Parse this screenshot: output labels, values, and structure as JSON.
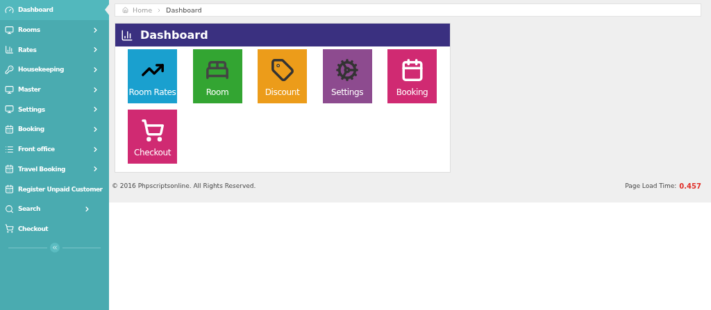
{
  "sidebar": {
    "items": [
      {
        "label": "Dashboard",
        "selected": true,
        "expandable": false
      },
      {
        "label": "Rooms",
        "selected": false,
        "expandable": true
      },
      {
        "label": "Rates",
        "selected": false,
        "expandable": true
      },
      {
        "label": "Housekeeping",
        "selected": false,
        "expandable": true
      },
      {
        "label": "Master",
        "selected": false,
        "expandable": true
      },
      {
        "label": "Settings",
        "selected": false,
        "expandable": true
      },
      {
        "label": "Booking",
        "selected": false,
        "expandable": true
      },
      {
        "label": "Front office",
        "selected": false,
        "expandable": true
      },
      {
        "label": "Travel Booking",
        "selected": false,
        "expandable": true
      },
      {
        "label": "Register Unpaid Customer",
        "selected": false,
        "expandable": false
      },
      {
        "label": "Search",
        "selected": false,
        "expandable": true
      },
      {
        "label": "Checkout",
        "selected": false,
        "expandable": false
      }
    ]
  },
  "breadcrumb": [
    "Home",
    "Dashboard"
  ],
  "panel": {
    "title": "Dashboard",
    "tiles": [
      {
        "label": "Room Rates",
        "color": "#1aa0cf"
      },
      {
        "label": "Room",
        "color": "#33a532"
      },
      {
        "label": "Discount",
        "color": "#ec9c1a"
      },
      {
        "label": "Settings",
        "color": "#8d4b8f"
      },
      {
        "label": "Booking",
        "color": "#d02a72"
      },
      {
        "label": "Checkout",
        "color": "#d02a72"
      }
    ]
  },
  "footer": {
    "copyright": "© 2016 Phpscriptsonline. All Rights Reserved.",
    "load_label": "Page Load Time:",
    "load_value": "0.457"
  }
}
